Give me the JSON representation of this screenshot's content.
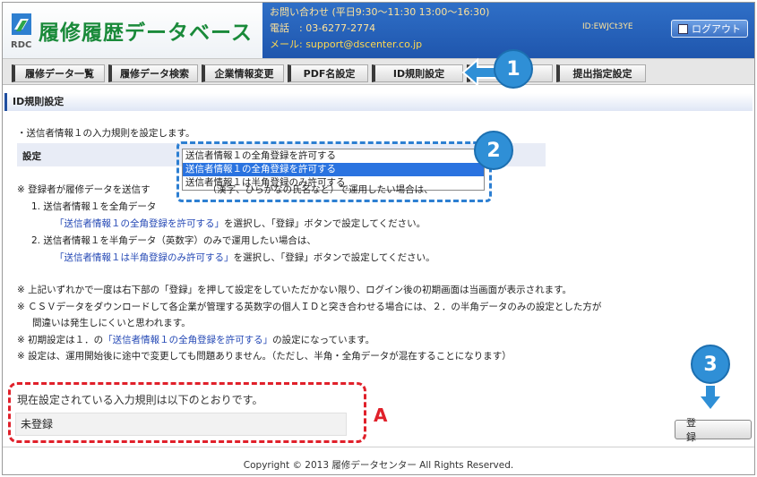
{
  "header": {
    "app_title": "履修履歴データベース",
    "logo_caption": "RDC",
    "contact_hours": "お問い合わせ (平日9:30～11:30 13:00～16:30)",
    "contact_phone": "電話　: 03-6277-2774",
    "contact_email": "メール: support@dscenter.co.jp",
    "user_id": "ID:EWJCt3YE",
    "logout_label": "ログアウト"
  },
  "nav": {
    "tabs": [
      {
        "label": "履修データ一覧"
      },
      {
        "label": "履修データ検索"
      },
      {
        "label": "企業情報変更"
      },
      {
        "label": "PDF名設定"
      },
      {
        "label": "ID規則設定"
      },
      {
        "label": ""
      },
      {
        "label": "提出指定設定"
      }
    ]
  },
  "page": {
    "section_title": "ID規則設定",
    "intro": "・送信者情報１の入力規則を設定します。",
    "setting_label": "設定",
    "dropdown_options": [
      "送信者情報１の全角登録を許可する",
      "送信者情報１の全角登録を許可する",
      "送信者情報１は半角登録のみ許可する"
    ],
    "notes": {
      "line1_prefix": "※ 登録者が履修データを送信す",
      "line1_suffix": "（漢字、ひらがなの氏名など）で運用したい場合は、",
      "line1_mid": "を全角データ",
      "item1_prefix": "1. 送信者情報１",
      "item1_hl": "「送信者情報１の全角登録を許可する」",
      "item1_suffix": "を選択し、「登録」ボタンで設定してください。",
      "item2": "2. 送信者情報１を半角データ（英数字）のみで運用したい場合は、",
      "item2_hl": "「送信者情報１は半角登録のみ許可する」",
      "item2_suffix": "を選択し、「登録」ボタンで設定してください。"
    },
    "notes2": {
      "n1": "※ 上記いずれかで一度は右下部の「登録」を押して設定をしていただかない限り、ログイン後の初期画面は当画面が表示されます。",
      "n2": "※ ＣＳＶデータをダウンロードして各企業が管理する英数字の個人ＩＤと突き合わせる場合には、２．の半角データのみの設定とした方が",
      "n2b": "間違いは発生しにくいと思われます。",
      "n3_prefix": "※ 初期設定は１．の",
      "n3_hl": "「送信者情報１の全角登録を許可する」",
      "n3_suffix": "の設定になっています。",
      "n4": "※ 設定は、運用開始後に途中で変更しても問題ありません。（ただし、半角・全角データが混在することになります）"
    },
    "current_title": "現在設定されている入力規則は以下のとおりです。",
    "current_value": "未登録",
    "register_label": "登　録"
  },
  "footer": {
    "copyright": "Copyright © 2013 履修データセンター All Rights Reserved."
  },
  "annotations": {
    "step1": "1",
    "step2": "2",
    "step3": "3",
    "letter_a": "A"
  },
  "colors": {
    "header_blue": "#2f6fc7",
    "brand_green": "#1a8a3a",
    "annotation_blue": "#2f8fd6",
    "annotation_red": "#e0202a",
    "selected_option": "#2a73e0"
  }
}
